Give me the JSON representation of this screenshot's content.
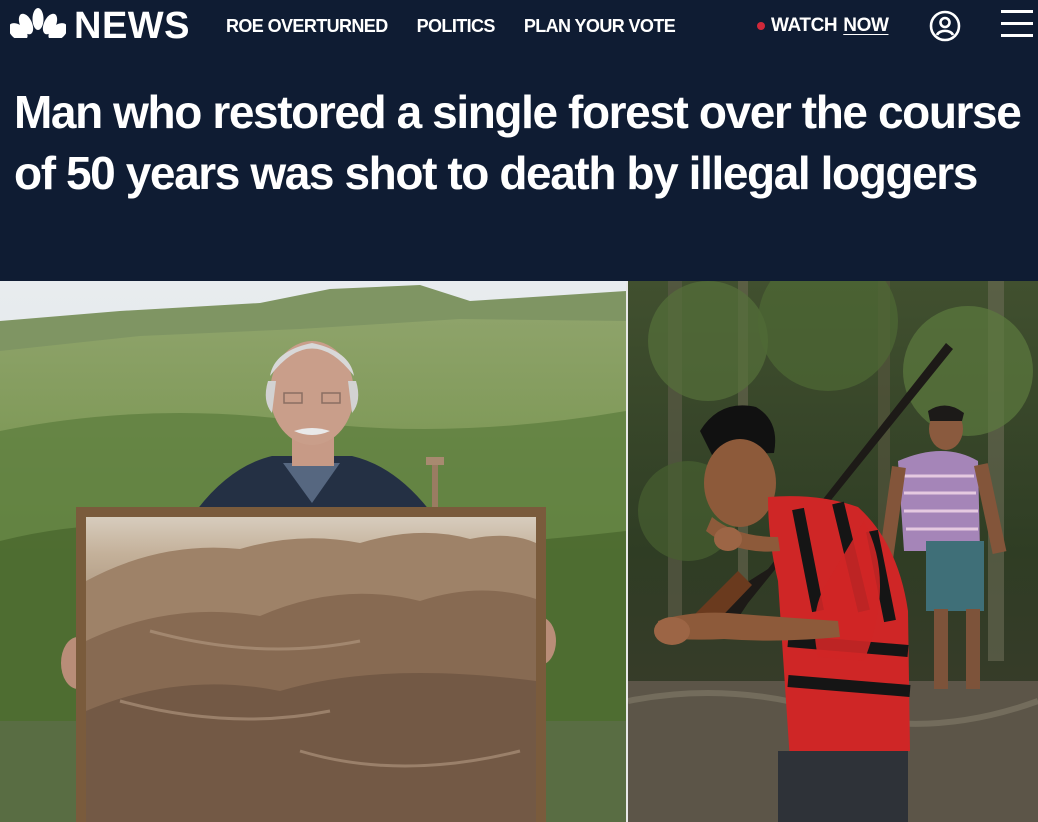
{
  "brand": {
    "logo_text": "NEWS"
  },
  "nav": {
    "items": [
      {
        "label": "ROE OVERTURNED"
      },
      {
        "label": "POLITICS"
      },
      {
        "label": "PLAN YOUR VOTE"
      }
    ]
  },
  "watch": {
    "word": "WATCH",
    "now": "NOW"
  },
  "article": {
    "headline": "Man who restored a single forest over the course of 50 years was shot to death by illegal loggers"
  },
  "colors": {
    "header_bg": "#0f1c33",
    "live_dot": "#d0283a",
    "text": "#ffffff"
  },
  "icons": {
    "logo": "peacock-icon",
    "account": "user-circle-icon",
    "menu": "hamburger-menu-icon"
  }
}
